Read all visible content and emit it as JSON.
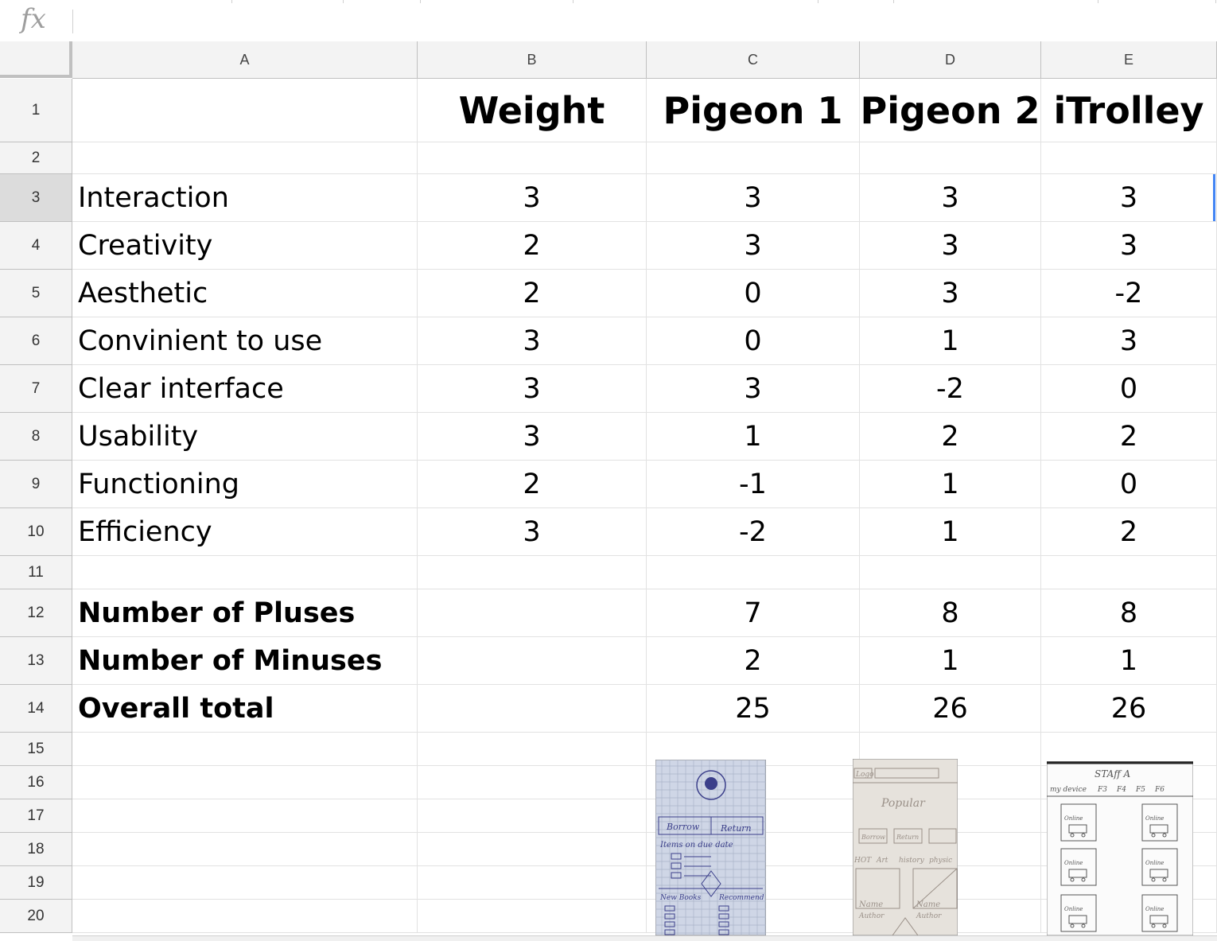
{
  "formula_bar": {
    "fx_label": "fx",
    "value": ""
  },
  "columns": [
    "A",
    "B",
    "C",
    "D",
    "E"
  ],
  "rows": [
    "1",
    "2",
    "3",
    "4",
    "5",
    "6",
    "7",
    "8",
    "9",
    "10",
    "11",
    "12",
    "13",
    "14",
    "15",
    "16",
    "17",
    "18",
    "19",
    "20"
  ],
  "active_row": "3",
  "cells": [
    [
      "",
      "Weight",
      "Pigeon 1",
      "Pigeon 2",
      "iTrolley"
    ],
    [
      "",
      "",
      "",
      "",
      ""
    ],
    [
      "Interaction",
      "3",
      "3",
      "3",
      "3"
    ],
    [
      "Creativity",
      "2",
      "3",
      "3",
      "3"
    ],
    [
      "Aesthetic",
      "2",
      "0",
      "3",
      "-2"
    ],
    [
      "Convinient to use",
      "3",
      "0",
      "1",
      "3"
    ],
    [
      "Clear interface",
      "3",
      "3",
      "-2",
      "0"
    ],
    [
      "Usability",
      "3",
      "1",
      "2",
      "2"
    ],
    [
      "Functioning",
      "2",
      "-1",
      "1",
      "0"
    ],
    [
      "Efficiency",
      "3",
      "-2",
      "1",
      "2"
    ],
    [
      "",
      "",
      "",
      "",
      ""
    ],
    [
      "Number of Pluses",
      "",
      "7",
      "8",
      "8"
    ],
    [
      "Number of Minuses",
      "",
      "2",
      "1",
      "1"
    ],
    [
      "Overall total",
      "",
      "25",
      "26",
      "26"
    ],
    [
      "",
      "",
      "",
      "",
      ""
    ],
    [
      "",
      "",
      "",
      "",
      ""
    ],
    [
      "",
      "",
      "",
      "",
      ""
    ],
    [
      "",
      "",
      "",
      "",
      ""
    ],
    [
      "",
      "",
      "",
      "",
      ""
    ],
    [
      "",
      "",
      "",
      "",
      ""
    ]
  ],
  "images": [
    {
      "name": "pigeon-1-sketch",
      "texts": [
        "Borrow",
        "Return",
        "Items on due date",
        "New Books",
        "Recommend"
      ]
    },
    {
      "name": "pigeon-2-sketch",
      "texts": [
        "Logo",
        "Popular",
        "Borrow",
        "Return",
        "HOT",
        "Art",
        "history",
        "physic",
        "Name",
        "Author"
      ]
    },
    {
      "name": "itrolley-sketch",
      "texts": [
        "STAff A",
        "my device",
        "F3",
        "F4",
        "F5",
        "F6",
        "Online"
      ]
    }
  ]
}
